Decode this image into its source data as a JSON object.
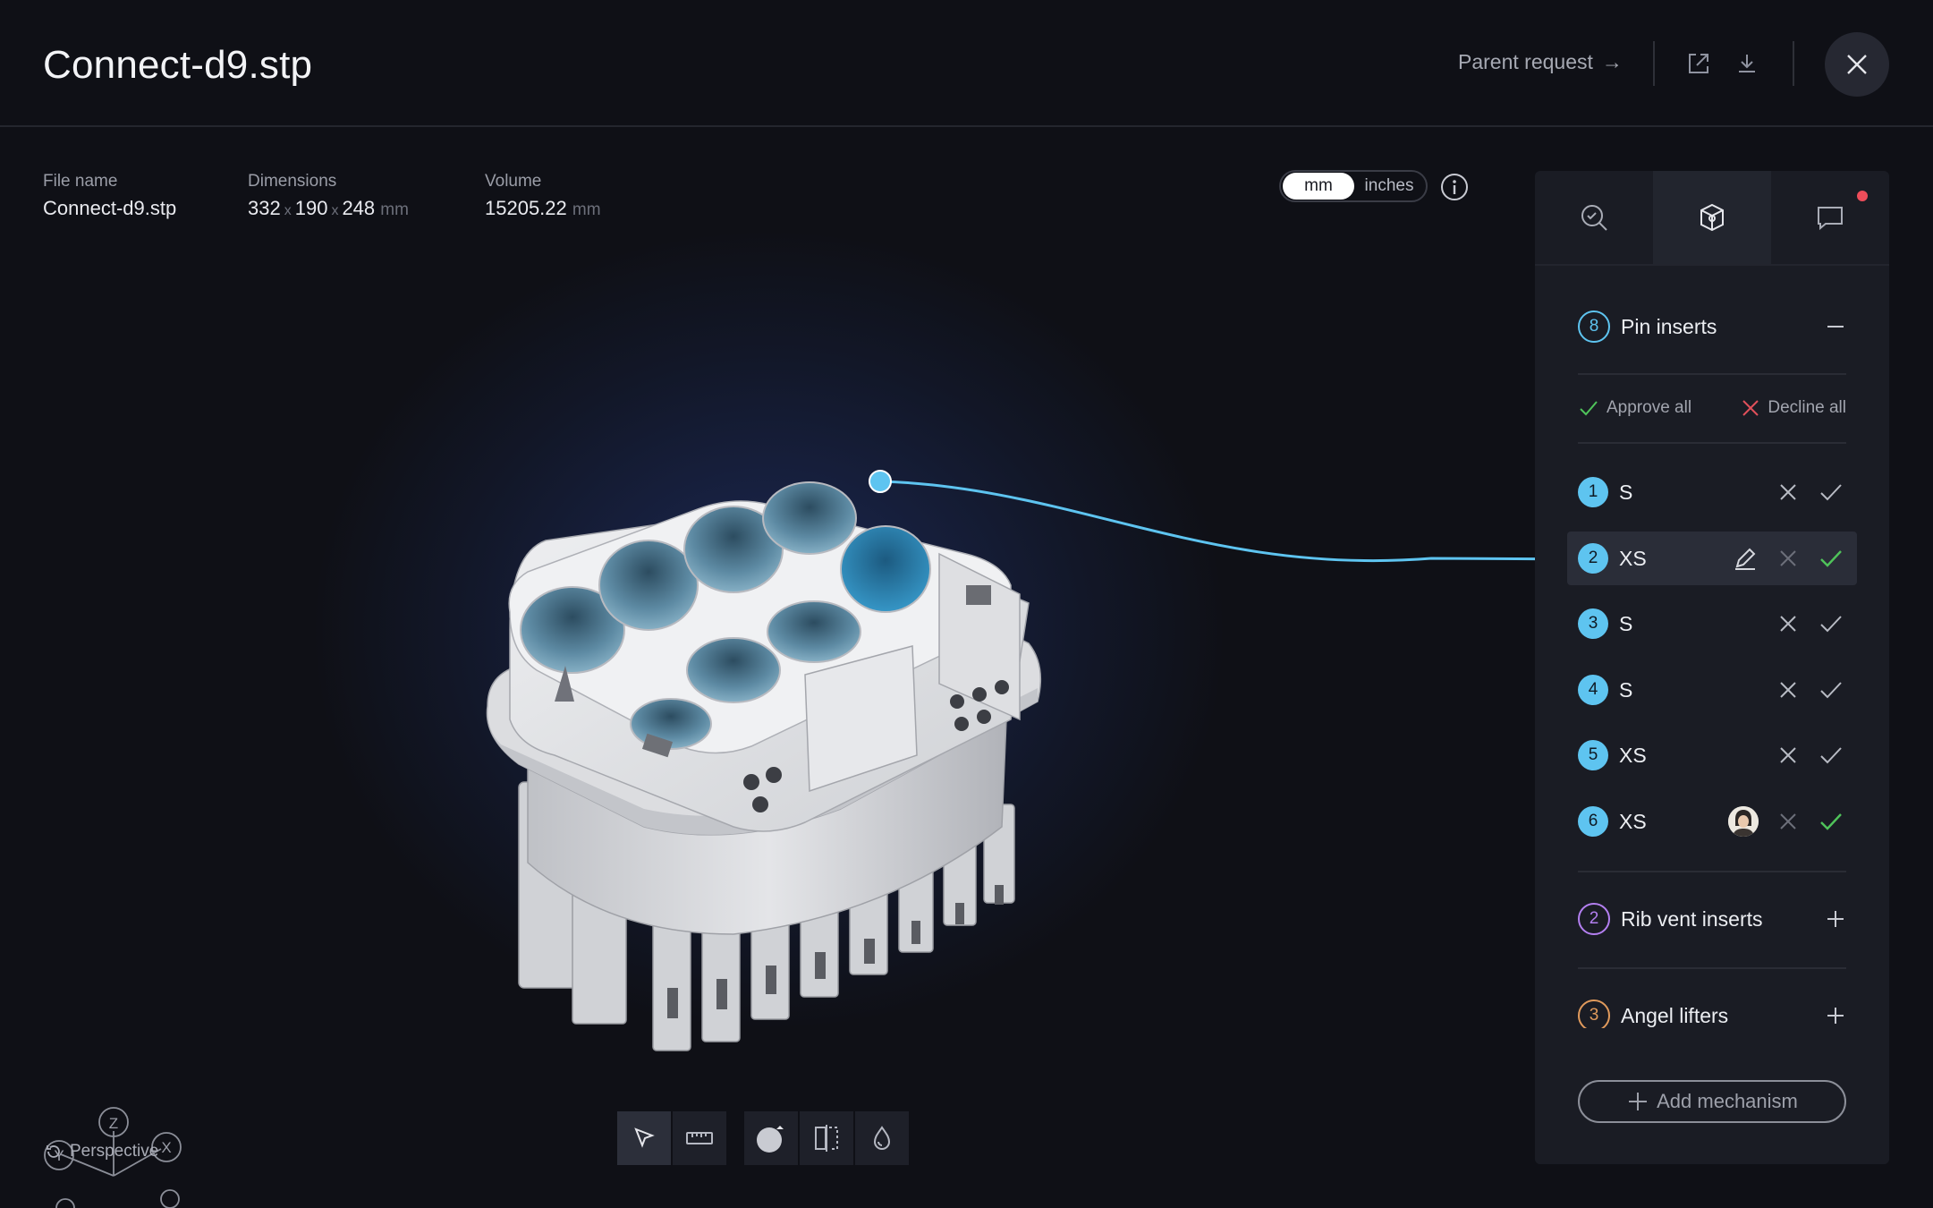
{
  "header": {
    "title": "Connect-d9.stp",
    "parent_link": "Parent request",
    "parent_arrow": "→"
  },
  "meta": {
    "file_name_label": "File name",
    "file_name_value": "Connect-d9.stp",
    "dimensions_label": "Dimensions",
    "dim_x": "332",
    "dim_y": "190",
    "dim_z": "248",
    "dim_sep": "x",
    "dim_unit": "mm",
    "volume_label": "Volume",
    "volume_value": "15205.22",
    "volume_unit": "mm"
  },
  "units": {
    "active": "mm",
    "inactive": "inches"
  },
  "gizmo": {
    "z": "Z",
    "y": "Y",
    "x": "X"
  },
  "perspective_label": "Perspective",
  "panel": {
    "pin_section": {
      "count": "8",
      "title": "Pin inserts"
    },
    "approve_all": "Approve all",
    "decline_all": "Decline all",
    "rows": [
      {
        "num": "1",
        "size": "S"
      },
      {
        "num": "2",
        "size": "XS"
      },
      {
        "num": "3",
        "size": "S"
      },
      {
        "num": "4",
        "size": "S"
      },
      {
        "num": "5",
        "size": "XS"
      },
      {
        "num": "6",
        "size": "XS"
      }
    ],
    "rib_section": {
      "count": "2",
      "title": "Rib vent inserts"
    },
    "angel_section": {
      "count": "3",
      "title": "Angel lifters"
    },
    "add_mechanism": "Add mechanism"
  },
  "colors": {
    "accent_blue": "#5ec4f0",
    "approve_green": "#4fc35a",
    "decline_red": "#e0505a",
    "notification_dot": "#ee4d5a"
  }
}
